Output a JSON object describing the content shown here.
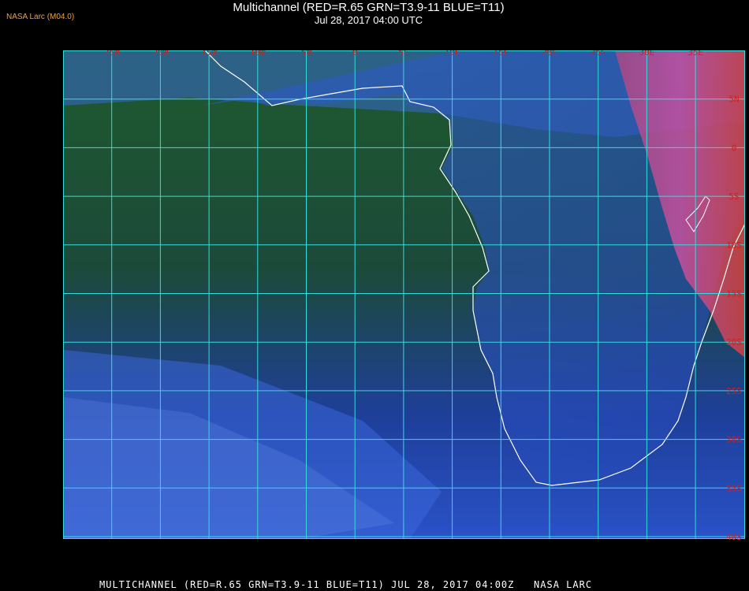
{
  "producer": "NASA Larc (M04.0)",
  "title": "Multichannel (RED=R.65 GRN=T3.9-11 BLUE=T11)",
  "subtitle": "Jul 28, 2017 04:00 UTC",
  "footer": "MULTICHANNEL (RED=R.65 GRN=T3.9-11 BLUE=T11) JUL 28, 2017 04:00Z   NASA LARC",
  "colors": {
    "grid": "#33dddd",
    "label": "#d02020",
    "coast": "#ffffff",
    "ocean": "#1e3a9a",
    "land": "#2a4fd0",
    "desert_hot": "#d04060"
  },
  "map": {
    "longitude_labels": [
      "25W",
      "20W",
      "15W",
      "10W",
      "5W",
      "0",
      "5E",
      "10E",
      "15E",
      "20E",
      "25E",
      "30E",
      "35E"
    ],
    "latitude_labels": [
      "5N",
      "0",
      "5S",
      "10S",
      "15S",
      "20S",
      "25S",
      "30S",
      "35S",
      "40S"
    ]
  }
}
